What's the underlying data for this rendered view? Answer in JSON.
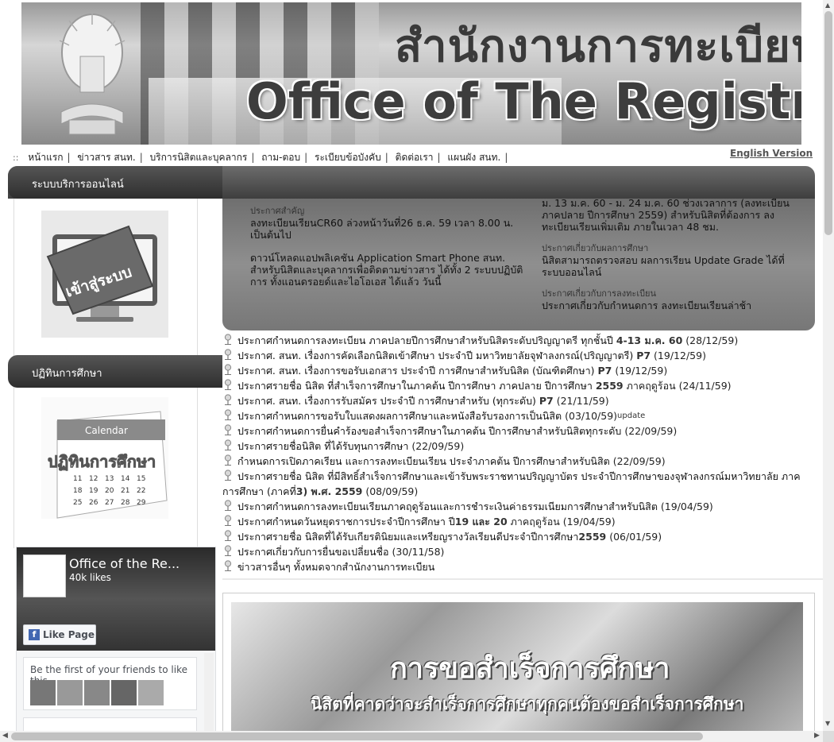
{
  "banner": {
    "thai_title": "สำนักงานการทะเบียน",
    "english_title": "Office of The Registrar"
  },
  "english_version": "English Version",
  "topnav": {
    "lead": "::",
    "items": [
      "หน้าแรก",
      "ข่าวสาร สนท.",
      "บริการนิสิตและบุคลากร",
      "ถาม-ตอบ",
      "ระเบียบข้อบังคับ",
      "ติดต่อเรา",
      "แผนผัง สนท."
    ]
  },
  "sidebar": {
    "section1_title": "ระบบบริการออนไลน์",
    "login_caption": "เข้าสู่ระบบ",
    "section2_title": "ปฏิทินการศึกษา",
    "calendar_caption": "ปฏิทินการศึกษา",
    "calendar_word": "Calendar"
  },
  "facebook": {
    "page_name": "Office of the Re...",
    "likes": "40k likes",
    "like_button": "Like Page",
    "friends_text": "Be the first of your friends to like this"
  },
  "slider": {
    "left_label": "ประกาศสำคัญ",
    "left_text1": "ลงทะเบียนเรียนCR60 ล่วงหน้าวันที่26 ธ.ค. 59 เวลา 8.00 น. เป็นต้นไป",
    "left_text2": "ดาวน์โหลดแอปพลิเคชัน Application Smart Phone สนท. สำหรับนิสิตและบุคลากรเพื่อติดตามข่าวสาร ได้ทั้ง 2 ระบบปฏิบัติการ ทั้งแอนดรอยด์และไอโอเอส ได้แล้ว วันนี้",
    "right_text1": "ม. 13 ม.ค. 60 - ม. 24 ม.ค. 60 ช่วงเวลาการ (ลงทะเบียน ภาคปลาย ปีการศึกษา 2559) สำหรับนิสิตที่ต้องการ ลงทะเบียนเรียนเพิ่มเติม ภายในเวลา 48 ชม.",
    "right_label2": "ประกาศเกี่ยวกับผลการศึกษา",
    "right_text2": "นิสิตสามารถตรวจสอบ ผลการเรียน Update Grade ได้ที่ ระบบออนไลน์",
    "right_label3": "ประกาศเกี่ยวกับการลงทะเบียน",
    "right_text3": "ประกาศเกี่ยวกับกำหนดการ ลงทะเบียนเรียนล่าช้า"
  },
  "news": [
    {
      "text": "ประกาศกำหนดการลงทะเบียน ภาคปลายปีการศึกษาสำหรับนิสิตระดับปริญญาตรี ทุกชั้นปี ",
      "bold": "4-13 ม.ค. 60",
      "date": "(28/12/59)"
    },
    {
      "text": "ประกาศ. สนท. เรื่องการคัดเลือกนิสิตเข้าศึกษา ประจำปี มหาวิทยาลัยจุฬาลงกรณ์(ปริญญาตรี) ",
      "bold": "P7",
      "date": "(19/12/59)"
    },
    {
      "text": "ประกาศ. สนท. เรื่องการขอรับเอกสาร ประจำปี การศึกษาสำหรับนิสิต (บัณฑิตศึกษา) ",
      "bold": "P7",
      "date": "(19/12/59)"
    },
    {
      "text": "ประกาศรายชื่อ นิสิต ที่สำเร็จการศึกษาในภาคต้น ปีการศึกษา ภาคปลาย ปีการศึกษา ",
      "bold": "2559",
      "date": "ภาคฤดูร้อน (24/11/59)"
    },
    {
      "text": "ประกาศ. สนท. เรื่องการรับสมัคร ประจำปี การศึกษาสำหรับ (ทุกระดับ) ",
      "bold": "P7",
      "date": "(21/11/59)"
    },
    {
      "text": "ประกาศกำหนดการขอรับใบแสดงผลการศึกษาและหนังสือรับรองการเป็นนิสิต ",
      "bold": "",
      "date": "(03/10/59)",
      "update": "update"
    },
    {
      "text": "ประกาศกำหนดการยื่นคำร้องขอสำเร็จการศึกษาในภาคต้น ปีการศึกษาสำหรับนิสิตทุกระดับ ",
      "bold": "",
      "date": "(22/09/59)"
    },
    {
      "text": "ประกาศรายชื่อนิสิต ที่ได้รับทุนการศึกษา ",
      "bold": "",
      "date": "(22/09/59)"
    },
    {
      "text": "กำหนดการเปิดภาคเรียน และการลงทะเบียนเรียน ประจำภาคต้น ปีการศึกษาสำหรับนิสิต ",
      "bold": "",
      "date": "(22/09/59)"
    },
    {
      "text": "ประกาศรายชื่อ นิสิต ที่มีสิทธิ์สำเร็จการศึกษาและเข้ารับพระราชทานปริญญาบัตร ประจำปีการศึกษาของจุฬาลงกรณ์มหาวิทยาลัย ภาคการศึกษา (ภาคที่",
      "bold": "3) พ.ศ. 2559",
      "date": "(08/09/59)",
      "wrap": true
    },
    {
      "text": "ประกาศกำหนดการลงทะเบียนเรียนภาคฤดูร้อนและการชำระเงินค่าธรรมเนียมการศึกษาสำหรับนิสิต ",
      "bold": "",
      "date": "(19/04/59)"
    },
    {
      "text": "ประกาศกำหนดวันหยุดราชการประจำปีการศึกษา ปี",
      "bold": "19 และ 20",
      "date": "ภาคฤดูร้อน (19/04/59)"
    },
    {
      "text": "ประกาศรายชื่อ นิสิตที่ได้รับเกียรตินิยมและเหรียญรางวัลเรียนดีประจำปีการศึกษา",
      "bold": "2559",
      "date": "(06/01/59)"
    },
    {
      "text": "ประกาศเกี่ยวกับการยื่นขอเปลี่ยนชื่อ ",
      "bold": "",
      "date": "(30/11/58)"
    },
    {
      "text": "ข่าวสารอื่นๆ ทั้งหมดจากสำนักงานการทะเบียน",
      "bold": "",
      "date": ""
    }
  ],
  "graduation": {
    "title": "การขอสำเร็จการศึกษา",
    "subtitle": "นิสิตที่คาดว่าจะสำเร็จการศึกษาทุกคนต้องขอสำเร็จการศึกษา"
  }
}
